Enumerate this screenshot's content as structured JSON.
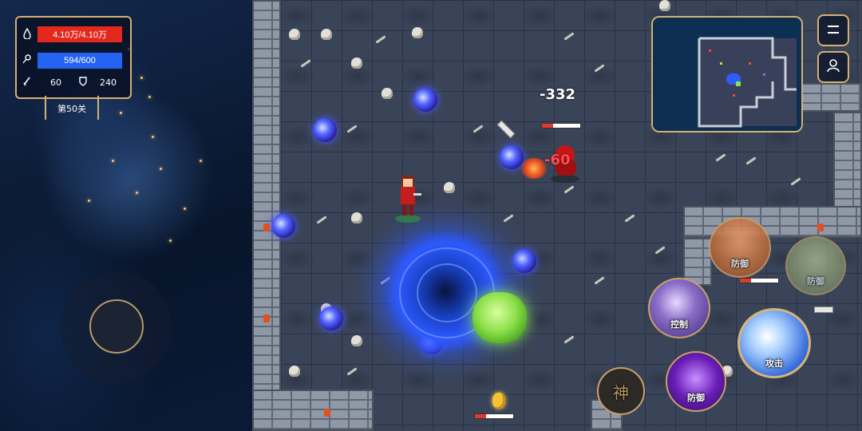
{
  "hud": {
    "hp_text": "4.10万/4.10万",
    "mp_text": "594/600",
    "attack_value": "60",
    "defense_value": "240",
    "level_label": "第50关",
    "hp_icon": "drop-icon",
    "mp_icon": "key-icon",
    "attack_icon": "sword-icon",
    "defense_icon": "shield-icon",
    "hp_color": "#e4281c",
    "mp_color": "#2463f0"
  },
  "combat": {
    "damage_large": "-332",
    "damage_small": "-60",
    "enemy_hp_fraction": 0.3
  },
  "top_buttons": {
    "menu_icon": "menu-icon",
    "profile_icon": "profile-icon"
  },
  "skills": {
    "defense_top": "防御",
    "defense_faded": "防御",
    "control": "控制",
    "attack": "攻击",
    "defense_bottom": "防御",
    "god": "神"
  }
}
